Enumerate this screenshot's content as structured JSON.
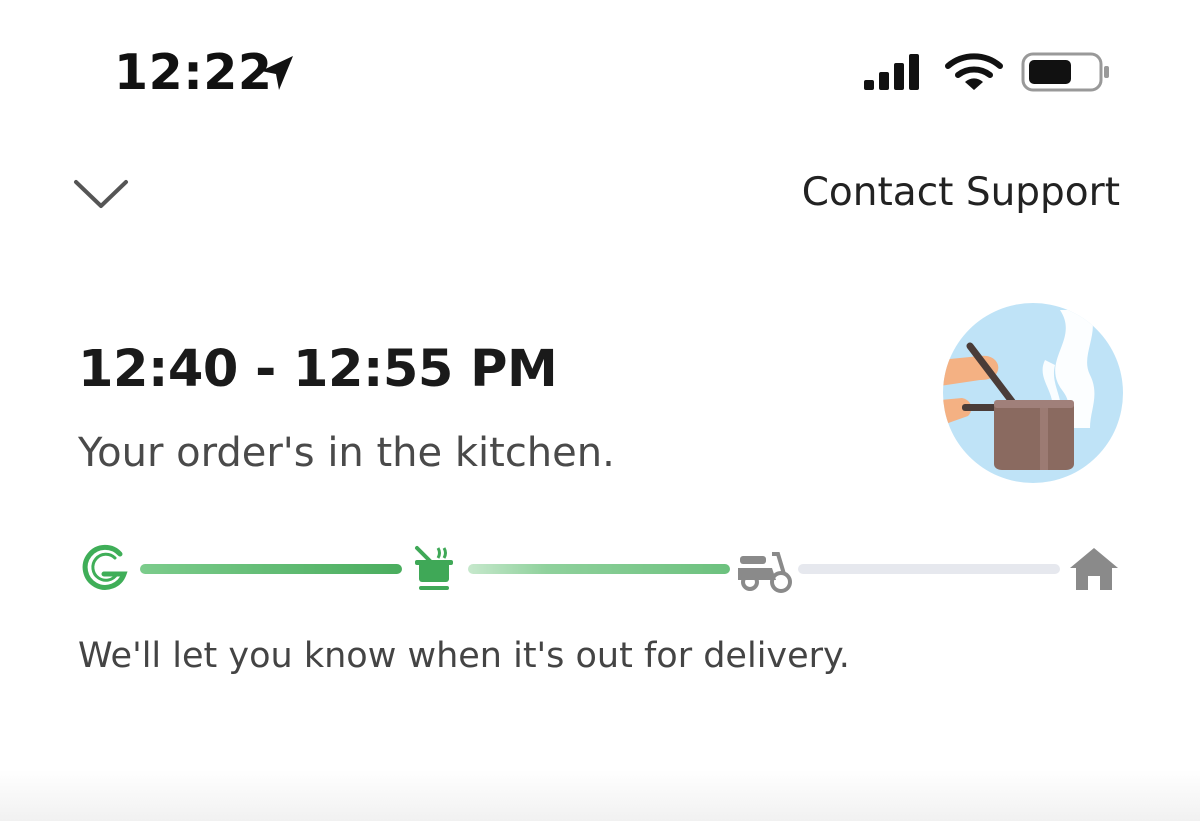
{
  "status_bar": {
    "time": "12:22",
    "icons": [
      "location-arrow-icon",
      "cellular-signal-icon",
      "wifi-icon",
      "battery-icon"
    ]
  },
  "header": {
    "collapse_icon": "chevron-down-icon",
    "contact_support_label": "Contact Support"
  },
  "order": {
    "eta": "12:40 - 12:55 PM",
    "status": "Your order's in the kitchen.",
    "illustration": "cooking-pot-illustration"
  },
  "progress": {
    "steps": [
      {
        "icon": "grubhub-g-icon",
        "state": "done"
      },
      {
        "icon": "cooking-pot-icon",
        "state": "active"
      },
      {
        "icon": "scooter-icon",
        "state": "pending"
      },
      {
        "icon": "home-icon",
        "state": "pending"
      }
    ],
    "segments_fill": [
      1.0,
      1.0,
      0.0
    ],
    "colors": {
      "green_dark": "#4caf5e",
      "green_mid": "#7dc98a",
      "green_light": "#b9e2c0",
      "gray": "#e6e8ee",
      "icon_gray": "#8a8a8a"
    }
  },
  "delivery_note": "We'll let you know when it's out for delivery."
}
